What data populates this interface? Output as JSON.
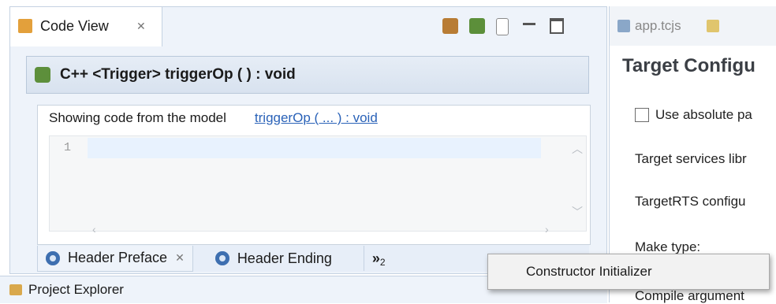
{
  "left_view": {
    "tab_title": "Code View",
    "editor_header": "C++ <Trigger> triggerOp ( ) : void",
    "showing_text": "Showing code from the model",
    "showing_link": "triggerOp ( ... ) : void",
    "line_number": "1",
    "bottom_tabs": [
      "Header Preface",
      "Header Ending"
    ],
    "overflow_label": "»",
    "overflow_count": "2",
    "toolbar_icons": [
      "tree-gear-icon",
      "tree-gear-2-icon",
      "document-icon",
      "minimize-icon",
      "maximize-icon"
    ]
  },
  "right_view": {
    "tab_title": "app.tcjs",
    "section_title": "Target Configu",
    "checkbox_label": "Use absolute pa",
    "target_services": "Target services libr",
    "targetrts": "TargetRTS configu",
    "make_type": "Make type:",
    "compile_args": "Compile argument"
  },
  "popup": {
    "item": "Constructor Initializer"
  },
  "bottom_strip": {
    "title": "Project Explorer"
  },
  "colors": {
    "link": "#2a62b8",
    "header_bg": "#e6edf6",
    "accent": "#3e6fb0"
  }
}
